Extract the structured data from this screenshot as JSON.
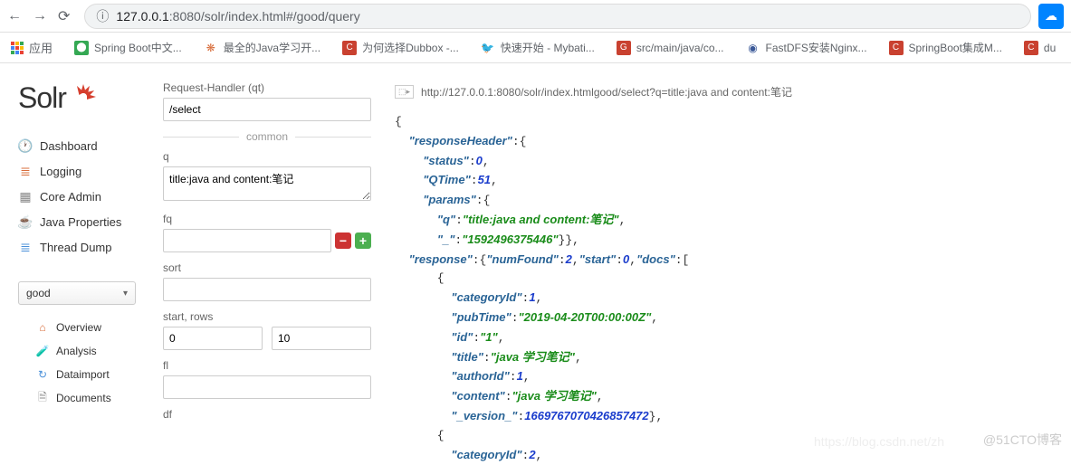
{
  "browser": {
    "url_domain": "127.0.0.1",
    "url_port": ":8080",
    "url_path": "/solr/index.html#/good/query",
    "info_icon": "ⓘ"
  },
  "bookmarks": {
    "apps_label": "应用",
    "items": [
      {
        "label": "Spring Boot中文...",
        "icon_type": "green"
      },
      {
        "label": "最全的Java学习开...",
        "icon_type": "orange"
      },
      {
        "label": "为何选择Dubbox -...",
        "icon_type": "red"
      },
      {
        "label": "快速开始 - Mybati...",
        "icon_type": "dark"
      },
      {
        "label": "src/main/java/co...",
        "icon_type": "red"
      },
      {
        "label": "FastDFS安装Nginx...",
        "icon_type": "blue"
      },
      {
        "label": "SpringBoot集成M...",
        "icon_type": "red"
      },
      {
        "label": "du",
        "icon_type": "red"
      }
    ]
  },
  "sidebar": {
    "logo_text": "Solr",
    "nav": [
      {
        "label": "Dashboard",
        "icon": "📊"
      },
      {
        "label": "Logging",
        "icon": "📋"
      },
      {
        "label": "Core Admin",
        "icon": "▦"
      },
      {
        "label": "Java Properties",
        "icon": "📄"
      },
      {
        "label": "Thread Dump",
        "icon": "≡"
      }
    ],
    "core_selected": "good",
    "sub_nav": [
      {
        "label": "Overview",
        "icon": "🏠"
      },
      {
        "label": "Analysis",
        "icon": "📈"
      },
      {
        "label": "Dataimport",
        "icon": "↻"
      },
      {
        "label": "Documents",
        "icon": "📄"
      }
    ]
  },
  "query": {
    "qt_label": "Request-Handler (qt)",
    "qt_value": "/select",
    "common_label": "common",
    "q_label": "q",
    "q_value": "title:java and content:笔记",
    "fq_label": "fq",
    "fq_value": "",
    "sort_label": "sort",
    "sort_value": "",
    "start_rows_label": "start, rows",
    "start_value": "0",
    "rows_value": "10",
    "fl_label": "fl",
    "fl_value": "",
    "df_label": "df"
  },
  "results": {
    "display_url": "http://127.0.0.1:8080/solr/index.htmlgood/select?q=title:java and content:笔记",
    "json": {
      "responseHeader": {
        "status": 0,
        "QTime": 51,
        "params": {
          "q": "title:java and content:笔记",
          "_": "1592496375446"
        }
      },
      "response": {
        "numFound": 2,
        "start": 0,
        "docs": [
          {
            "categoryId": 1,
            "pubTime": "2019-04-20T00:00:00Z",
            "id": "1",
            "title": "java 学习笔记",
            "authorId": 1,
            "content": "java 学习笔记",
            "_version_": "1669767070426857472"
          },
          {
            "categoryId": 2
          }
        ]
      }
    }
  },
  "watermark": "@51CTO博客",
  "watermark2": "https://blog.csdn.net/zh"
}
